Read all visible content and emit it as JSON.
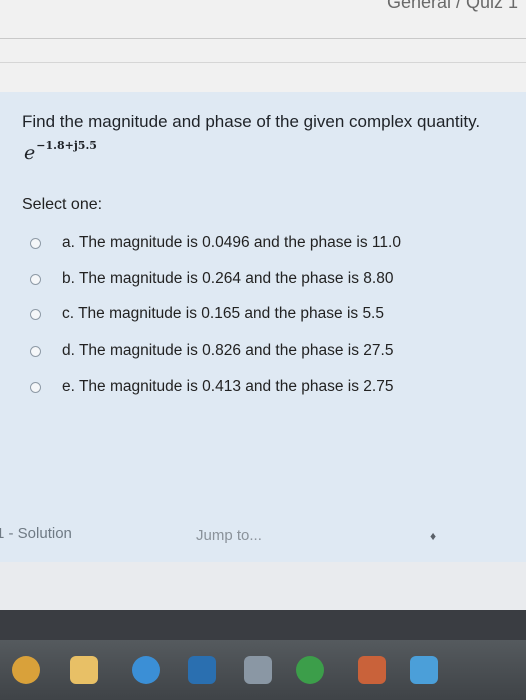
{
  "header": {
    "breadcrumb": "General / Quiz 1"
  },
  "question": {
    "prompt": "Find the magnitude and phase of the given complex quantity.",
    "formula_base": "e",
    "formula_exponent": "−1.8+j5.5",
    "select_label": "Select one:",
    "options": [
      {
        "label": "a. The magnitude is 0.0496 and the phase is 11.0"
      },
      {
        "label": "b. The magnitude is 0.264 and the phase is 8.80"
      },
      {
        "label": "c. The magnitude is 0.165 and the phase is 5.5"
      },
      {
        "label": "d. The magnitude is 0.826 and the phase is 27.5"
      },
      {
        "label": "e. The magnitude is 0.413 and the phase is 2.75"
      }
    ]
  },
  "navigation": {
    "prev_link": "1 - Solution",
    "jump_placeholder": "Jump to...",
    "jump_arrows": "♦"
  },
  "taskbar": {
    "icons": [
      "chrome-icon",
      "file-explorer-icon",
      "edge-icon",
      "photos-icon",
      "app-icon",
      "maps-icon",
      "store-icon",
      "teams-icon"
    ]
  },
  "colors": {
    "question_bg": "#dfe9f3",
    "taskbar_bg": "#4a4e52"
  }
}
